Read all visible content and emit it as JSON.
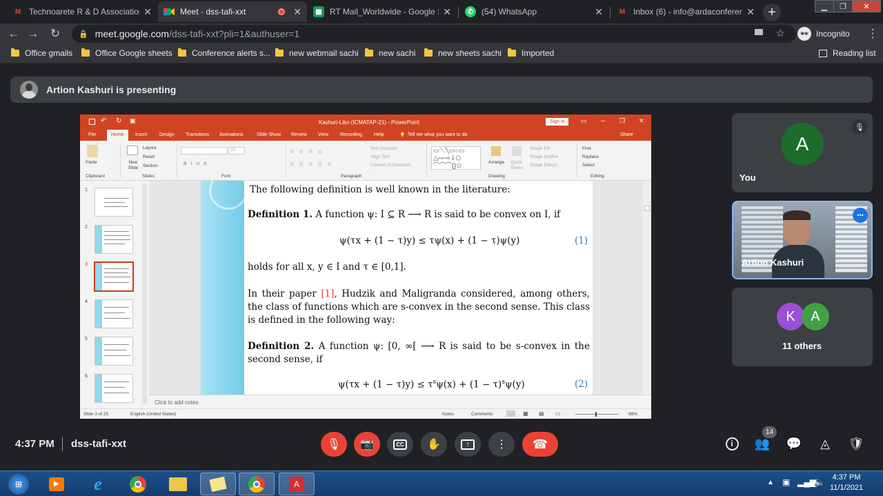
{
  "browser": {
    "tabs": [
      {
        "label": "Technoarete R & D Association |",
        "fav": "M"
      },
      {
        "label": "Meet - dss-tafi-xxt",
        "fav": "meet"
      },
      {
        "label": "RT Mail_Worldwide - Google Sh",
        "fav": "sheets"
      },
      {
        "label": "(54) WhatsApp",
        "fav": "wa"
      },
      {
        "label": "Inbox (6) - info@ardaconferenc",
        "fav": "M"
      }
    ],
    "url_host": "meet.google.com",
    "url_path": "/dss-tafi-xxt?pli=1&authuser=1",
    "profile_label": "Incognito",
    "bookmarks": [
      "Office gmails",
      "Office Google sheets",
      "Conference alerts s...",
      "new webmail sachi",
      "new sachi",
      "new sheets sachi",
      "Imported"
    ],
    "reading_list": "Reading list"
  },
  "meet": {
    "presenting_text": "Artion Kashuri is presenting",
    "time": "4:37 PM",
    "meeting_code": "dss-tafi-xxt",
    "people_count": "14",
    "tiles": {
      "you_initial": "A",
      "you_label": "You",
      "presenter_label": "Artion Kashuri",
      "others_initials": [
        "K",
        "A"
      ],
      "others_label": "11 others"
    }
  },
  "ppt": {
    "window_title": "Kashuri-Liko (ICMATAP-21) - PowerPoint",
    "sign_in": "Sign in",
    "menu": [
      "File",
      "Home",
      "Insert",
      "Design",
      "Transitions",
      "Animations",
      "Slide Show",
      "Review",
      "View",
      "Recording",
      "Help"
    ],
    "tell_me": "Tell me what you want to do",
    "share": "Share",
    "ribbon": {
      "paste": "Paste",
      "new_slide": "New Slide",
      "layout": "Layout",
      "reset": "Reset",
      "section": "Section",
      "font_size": "32",
      "text_direction": "Text Direction",
      "align_text": "Align Text",
      "convert_smartart": "Convert to SmartArt",
      "arrange": "Arrange",
      "quick_styles": "Quick Styles",
      "shape_fill": "Shape Fill",
      "shape_outline": "Shape Outline",
      "shape_effects": "Shape Effects",
      "find": "Find",
      "replace": "Replace",
      "select": "Select",
      "groups": [
        "Clipboard",
        "Slides",
        "Font",
        "Paragraph",
        "Drawing",
        "Editing"
      ]
    },
    "thumb_numbers": [
      "1",
      "2",
      "3",
      "4",
      "5",
      "6"
    ],
    "slide": {
      "intro": "The following definition is well known in the literature:",
      "def1_label": "Definition 1.",
      "def1_text": "A function ψ: I ⊆ R ⟶ R is said to be convex on I, if",
      "eq1": "ψ(τx + (1 − τ)y) ≤ τψ(x) + (1 − τ)ψ(y)",
      "eq1_num": "(1)",
      "holds": "holds for all x, y ∈ I and τ ∈ [0,1].",
      "para_a": "In their paper ",
      "para_ref": "[1]",
      "para_b": ", Hudzik and Maligranda considered, among others, the class of functions which are s-convex in the second sense. This class is defined in the following way:",
      "def2_label": "Definition 2.",
      "def2_text": "A function ψ: [0, ∞[ ⟶ R is said to be s-convex in the second sense, if",
      "eq2_a": "ψ(τx + (1 − τ)y) ≤ τ",
      "eq2_sup1": "s",
      "eq2_b": "ψ(x) + (1 − τ)",
      "eq2_sup2": "s",
      "eq2_c": "ψ(y)",
      "eq2_num": "(2)"
    },
    "notes_placeholder": "Click to add notes",
    "status": {
      "slide_of": "Slide 3 of 25",
      "language": "English (United States)",
      "notes": "Notes",
      "comments": "Comments",
      "zoom": "98%"
    }
  },
  "taskbar": {
    "time": "4:37 PM",
    "date": "11/1/2021"
  }
}
